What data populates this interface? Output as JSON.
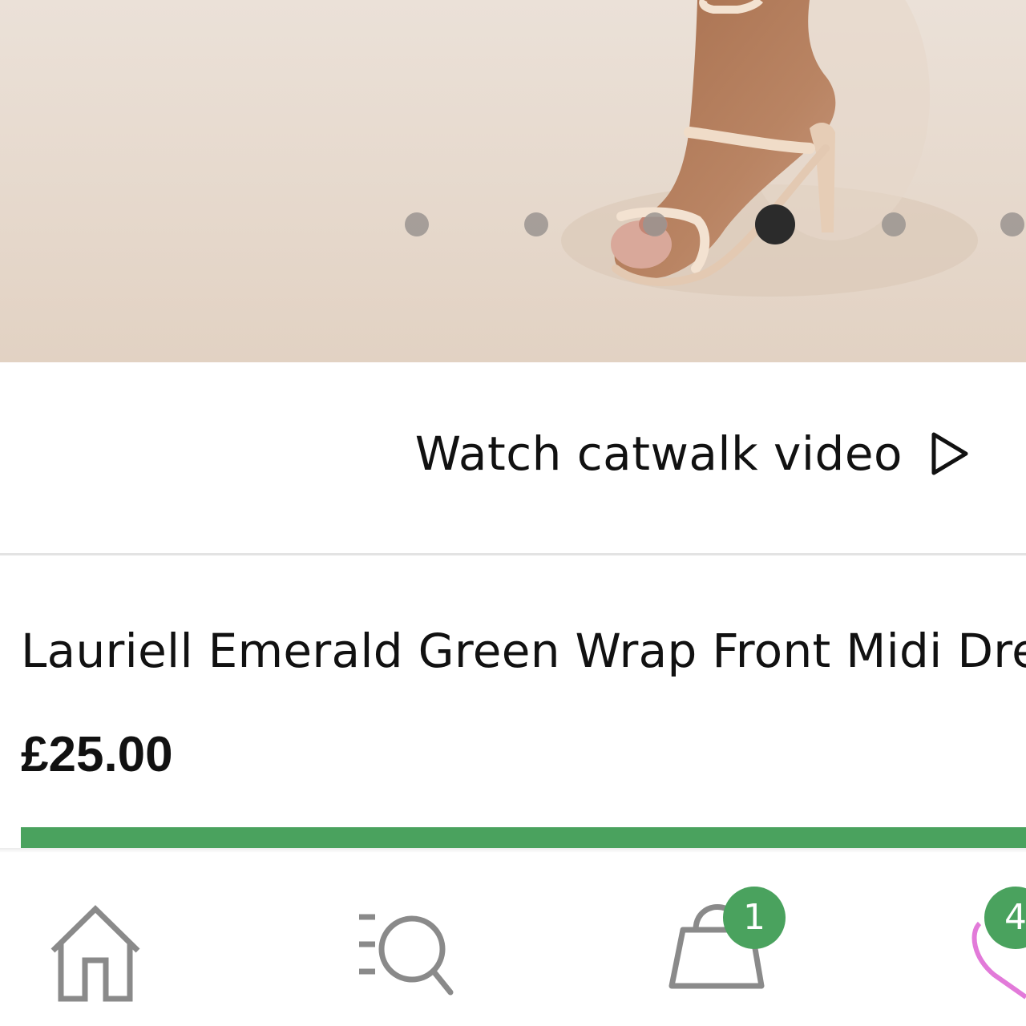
{
  "gallery": {
    "image_alt": "Nude barely-there strappy heeled sandal on foot",
    "dot_count": 6,
    "active_index": 3
  },
  "catwalk": {
    "label": "Watch catwalk video",
    "icon": "play-icon"
  },
  "product": {
    "title": "Lauriell Emerald Green Wrap Front Midi Dress",
    "price": "£25.00"
  },
  "colors": {
    "accent_green": "#4aa25e",
    "text": "#111111",
    "nav_icon": "#8a8a8a",
    "wishlist_pink": "#e27ad9"
  },
  "nav": {
    "home": {
      "icon": "home-icon"
    },
    "search": {
      "icon": "search-list-icon"
    },
    "bag": {
      "icon": "shopping-bag-icon",
      "badge": "1"
    },
    "wishlist": {
      "icon": "heart-icon",
      "badge": "4"
    }
  }
}
